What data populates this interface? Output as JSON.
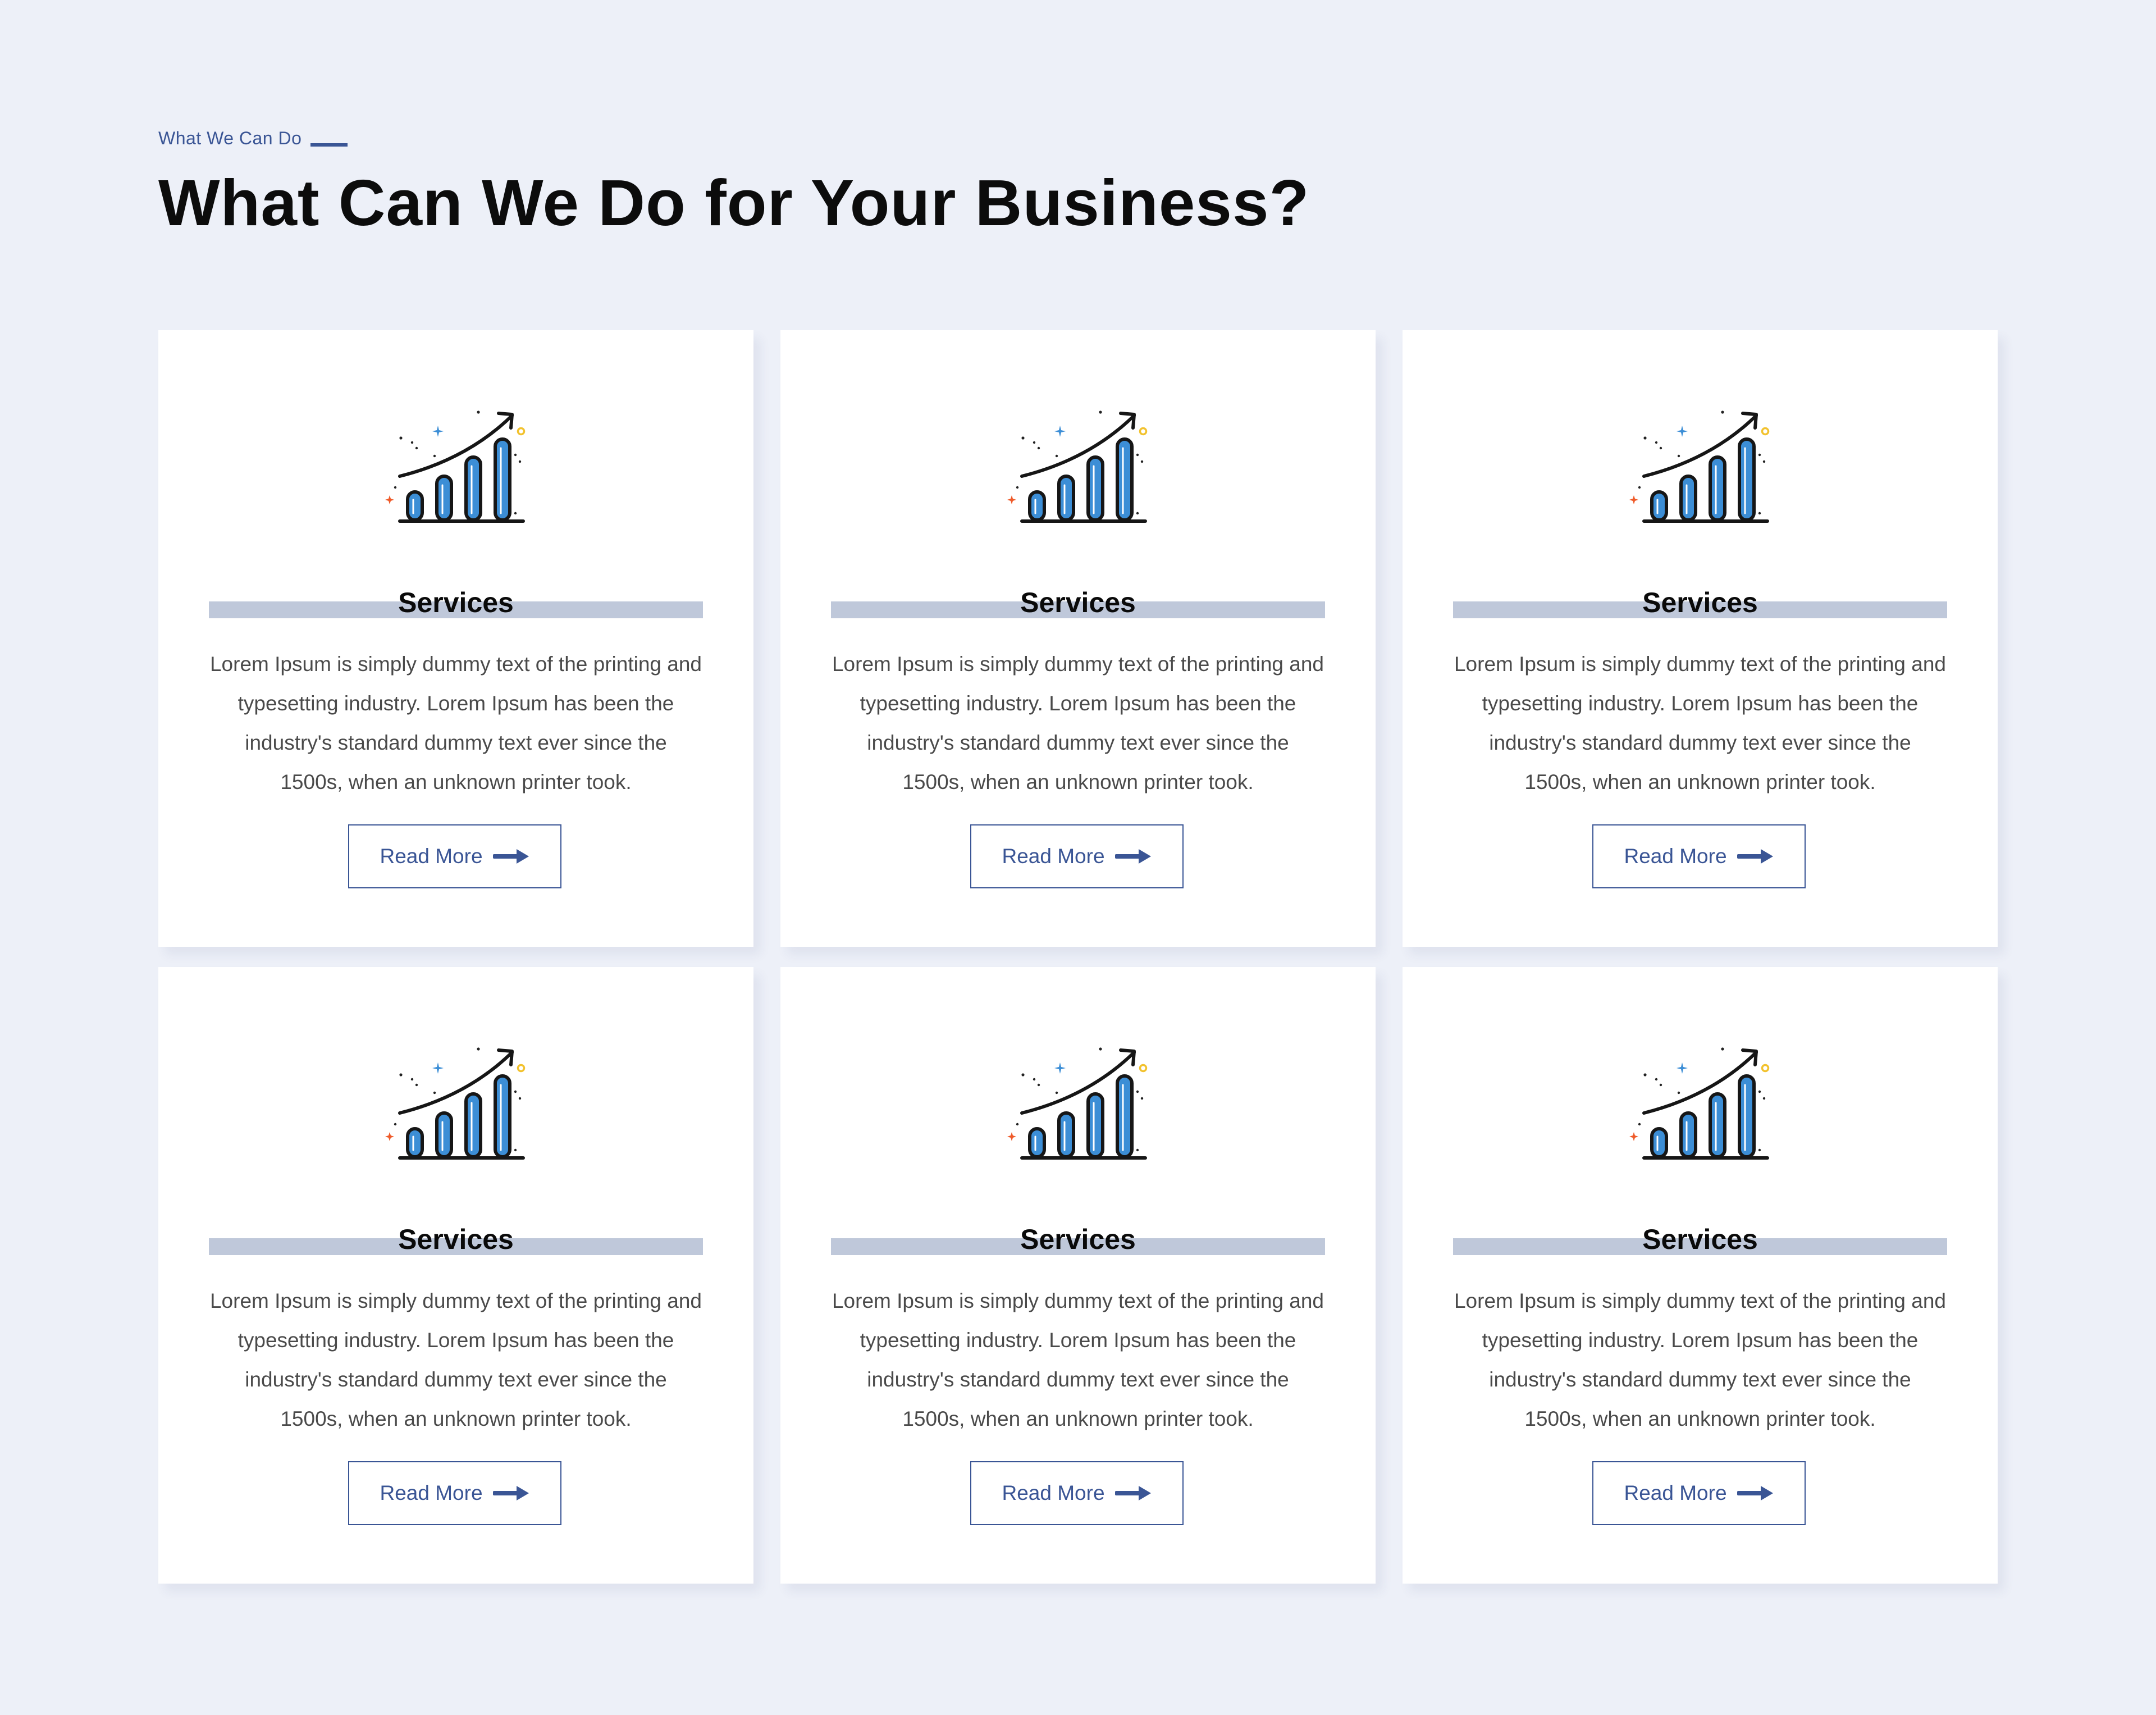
{
  "header": {
    "eyebrow": "What We Can Do",
    "title": "What Can We Do for Your Business?"
  },
  "colors": {
    "accent": "#3a5595",
    "background": "#edf0f8",
    "heading_bar": "#bfc8da",
    "icon_bar": "#3c8ed6"
  },
  "cards": [
    {
      "icon": "growth-chart-icon",
      "title": "Services",
      "lines": [
        "Lorem Ipsum is simply dummy text of the printing and",
        "typesetting industry.  Lorem Ipsum has been the",
        "industry's standard  dummy text ever since the",
        "1500s, when an unknown printer took."
      ],
      "button": "Read More"
    },
    {
      "icon": "growth-chart-icon",
      "title": "Services",
      "lines": [
        "Lorem Ipsum is simply dummy text of the printing and",
        "typesetting industry.  Lorem Ipsum has been the",
        "industry's standard  dummy text ever since the",
        "1500s, when an unknown printer took."
      ],
      "button": "Read More"
    },
    {
      "icon": "growth-chart-icon",
      "title": "Services",
      "lines": [
        "Lorem Ipsum is simply dummy text of the printing and",
        "typesetting industry.  Lorem Ipsum has been the",
        "industry's standard  dummy text ever since the",
        "1500s, when an unknown printer took."
      ],
      "button": "Read More"
    },
    {
      "icon": "growth-chart-icon",
      "title": "Services",
      "lines": [
        "Lorem Ipsum is simply dummy text of the printing and",
        "typesetting industry.  Lorem Ipsum has been the",
        "industry's standard  dummy text ever since the",
        "1500s, when an unknown printer took."
      ],
      "button": "Read More"
    },
    {
      "icon": "growth-chart-icon",
      "title": "Services",
      "lines": [
        "Lorem Ipsum is simply dummy text of the printing and",
        "typesetting industry.  Lorem Ipsum has been the",
        "industry's standard  dummy text ever since the",
        "1500s, when an unknown printer took."
      ],
      "button": "Read More"
    },
    {
      "icon": "growth-chart-icon",
      "title": "Services",
      "lines": [
        "Lorem Ipsum is simply dummy text of the printing and",
        "typesetting industry.  Lorem Ipsum has been the",
        "industry's standard  dummy text ever since the",
        "1500s, when an unknown printer took."
      ],
      "button": "Read More"
    }
  ]
}
